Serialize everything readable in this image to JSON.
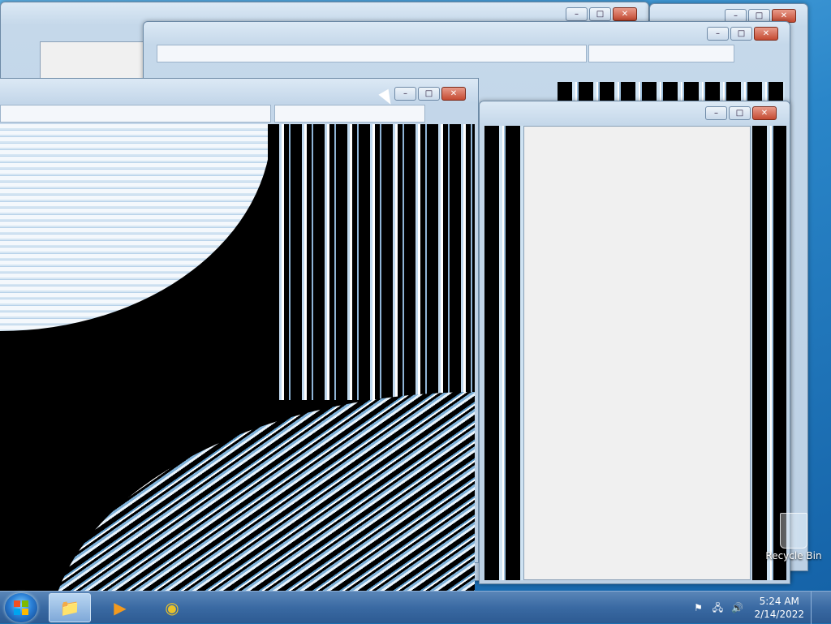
{
  "window_controls": {
    "minimize": "–",
    "maximize": "□",
    "close": "✕"
  },
  "desktop_icon": {
    "label": "Recycle Bin",
    "icon": "recycle-bin-icon"
  },
  "taskbar": {
    "start_icon": "windows-start-icon",
    "pinned": [
      {
        "name": "windows-explorer",
        "icon": "folder-icon",
        "glyph": "📁"
      },
      {
        "name": "windows-media-player",
        "icon": "media-player-icon",
        "glyph": "▶"
      },
      {
        "name": "google-chrome",
        "icon": "chrome-icon",
        "glyph": "◉"
      }
    ]
  },
  "tray": {
    "flag_glyph": "⚑",
    "network_glyph": "🖧",
    "volume_glyph": "🔊",
    "time": "5:24 AM",
    "date": "2/14/2022"
  },
  "colors": {
    "accent": "#2a86c9",
    "close_button": "#c44a32",
    "glitch_black": "#000000"
  }
}
